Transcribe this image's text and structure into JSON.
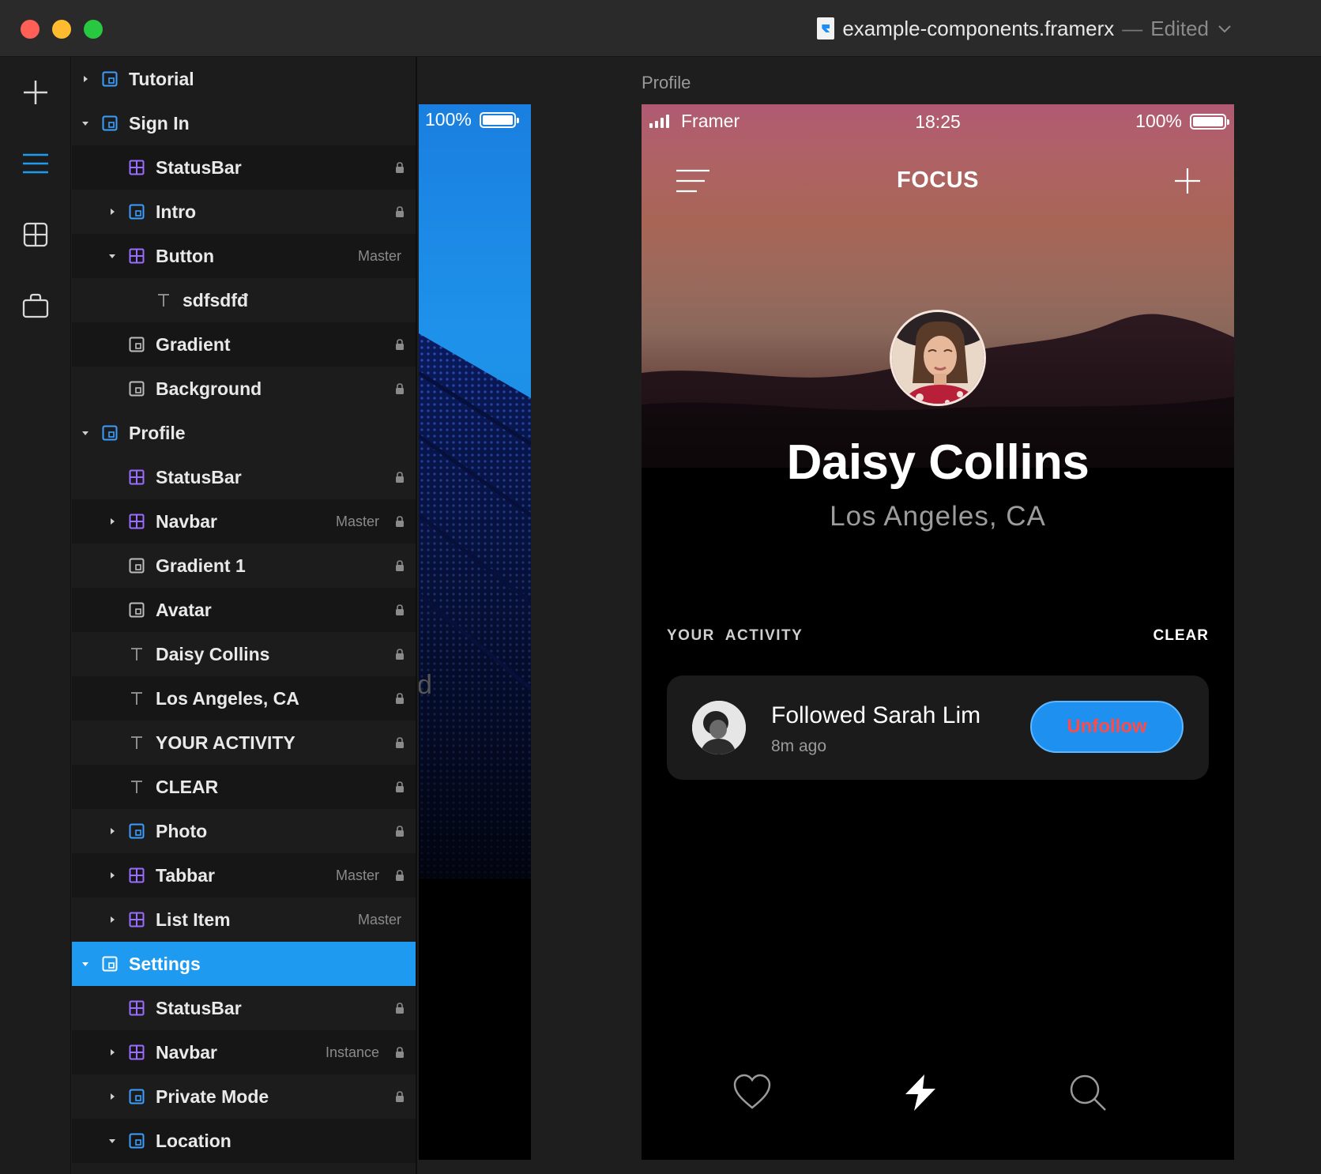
{
  "window": {
    "file_name": "example-components.framerx",
    "separator": "—",
    "status": "Edited"
  },
  "toolbar": {
    "icons": [
      "plus-icon",
      "layers-icon",
      "components-icon",
      "store-icon"
    ]
  },
  "layers": [
    {
      "name": "Tutorial",
      "icon": "frame",
      "expanded": false,
      "tag": "",
      "locked": false
    },
    {
      "name": "Sign In",
      "icon": "frame",
      "expanded": true,
      "tag": "",
      "locked": false
    },
    {
      "name": "StatusBar",
      "icon": "component",
      "tag": "",
      "locked": true
    },
    {
      "name": "Intro",
      "icon": "frame",
      "expanded": false,
      "tag": "",
      "locked": true
    },
    {
      "name": "Button",
      "icon": "component",
      "expanded": true,
      "tag": "Master",
      "locked": false
    },
    {
      "name": "sdfsdfđ",
      "icon": "text",
      "tag": "",
      "locked": false
    },
    {
      "name": "Gradient",
      "icon": "frame-gray",
      "tag": "",
      "locked": true
    },
    {
      "name": "Background",
      "icon": "frame-gray",
      "tag": "",
      "locked": true
    },
    {
      "name": "Profile",
      "icon": "frame",
      "expanded": true,
      "tag": "",
      "locked": false
    },
    {
      "name": "StatusBar",
      "icon": "component",
      "tag": "",
      "locked": true
    },
    {
      "name": "Navbar",
      "icon": "component",
      "expanded": false,
      "tag": "Master",
      "locked": true
    },
    {
      "name": "Gradient 1",
      "icon": "frame-gray",
      "tag": "",
      "locked": true
    },
    {
      "name": "Avatar",
      "icon": "frame-gray",
      "tag": "",
      "locked": true
    },
    {
      "name": "Daisy Collins",
      "icon": "text",
      "tag": "",
      "locked": true
    },
    {
      "name": "Los Angeles, CA",
      "icon": "text",
      "tag": "",
      "locked": true
    },
    {
      "name": "YOUR ACTIVITY",
      "icon": "text",
      "tag": "",
      "locked": true
    },
    {
      "name": "CLEAR",
      "icon": "text",
      "tag": "",
      "locked": true
    },
    {
      "name": "Photo",
      "icon": "frame",
      "expanded": false,
      "tag": "",
      "locked": true
    },
    {
      "name": "Tabbar",
      "icon": "component",
      "expanded": false,
      "tag": "Master",
      "locked": true
    },
    {
      "name": "List Item",
      "icon": "component",
      "expanded": false,
      "tag": "Master",
      "locked": false
    },
    {
      "name": "Settings",
      "icon": "frame",
      "expanded": true,
      "tag": "",
      "locked": false,
      "selected": true
    },
    {
      "name": "StatusBar",
      "icon": "component",
      "tag": "",
      "locked": true
    },
    {
      "name": "Navbar",
      "icon": "component",
      "expanded": false,
      "tag": "Instance",
      "locked": true
    },
    {
      "name": "Private Mode",
      "icon": "frame",
      "expanded": false,
      "tag": "",
      "locked": true
    },
    {
      "name": "Location",
      "icon": "frame",
      "expanded": true,
      "tag": "",
      "locked": false
    }
  ],
  "canvas": {
    "left_frame": {
      "battery": "100%",
      "partial_text": "d"
    },
    "profile_frame_label": "Profile"
  },
  "phone": {
    "carrier": "Framer",
    "time": "18:25",
    "battery": "100%",
    "brand": "FOCUS",
    "name": "Daisy Collins",
    "location": "Los Angeles, CA",
    "activity_label": "YOUR  ACTIVITY",
    "clear_label": "CLEAR",
    "card": {
      "title": "Followed Sarah Lim",
      "subtitle": "8m ago",
      "button": "Unfollow"
    },
    "tabs": [
      "heart-icon",
      "bolt-icon",
      "search-icon"
    ]
  },
  "colors": {
    "accent": "#1e9bf0",
    "component": "#9b6cff",
    "frame": "#3aa0ff",
    "unfollow_text": "#ff4a4a"
  }
}
